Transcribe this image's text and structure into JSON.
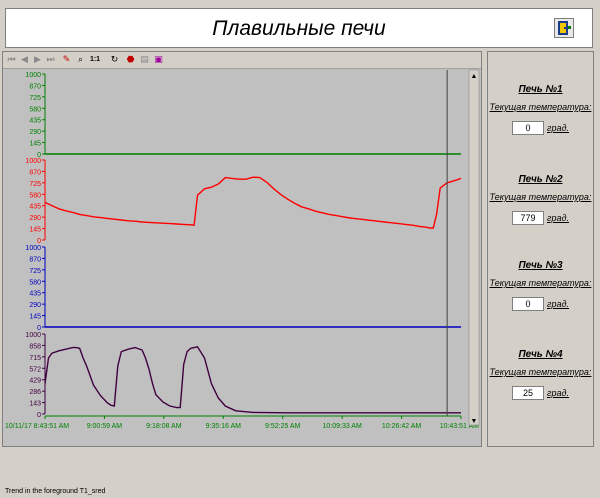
{
  "header": {
    "title": "Плавильные печи",
    "exit_icon": "door-exit-icon"
  },
  "toolbar": {
    "buttons": [
      "first-icon",
      "prev-icon",
      "next-icon",
      "last-icon",
      "pen-icon",
      "zoom-icon",
      "ratio-icon",
      "refresh-icon",
      "stop-icon",
      "print-icon",
      "export-icon"
    ],
    "ratio_label": "1:1"
  },
  "status": {
    "text": "Trend in the foreground T1_sred"
  },
  "colors": {
    "furnace1": "#008000",
    "furnace2": "#ff0000",
    "furnace3": "#0000c0",
    "furnace4": "#400040",
    "axis_time": "#008000",
    "plot_bg": "#c0c0c0"
  },
  "furnaces": [
    {
      "name": "Печь №1",
      "label": "Текущая температура:",
      "value": "0",
      "unit": "град."
    },
    {
      "name": "Печь №2",
      "label": "Текущая температура:",
      "value": "779",
      "unit": "град."
    },
    {
      "name": "Печь №3",
      "label": "Текущая температура:",
      "value": "0",
      "unit": "град."
    },
    {
      "name": "Печь №4",
      "label": "Текущая температура:",
      "value": "25",
      "unit": "град."
    }
  ],
  "chart_data": {
    "type": "line",
    "x_ticks": [
      "10/11/17 8:43:51 AM",
      "9:00:59 AM",
      "9:18:08 AM",
      "9:35:16 AM",
      "9:52:25 AM",
      "10:09:33 AM",
      "10:26:42 AM",
      "10:43:51 AM"
    ],
    "xlim": [
      0,
      120
    ],
    "cursor_x": 116,
    "panels": [
      {
        "ylim": [
          0,
          1000
        ],
        "y_ticks": [
          "0",
          "145",
          "290",
          "435",
          "580",
          "725",
          "870",
          "1000"
        ],
        "x": [
          0,
          120
        ],
        "y": [
          0,
          0
        ]
      },
      {
        "ylim": [
          0,
          1000
        ],
        "y_ticks": [
          "0",
          "145",
          "290",
          "435",
          "580",
          "725",
          "870",
          "1000"
        ],
        "x": [
          0,
          2,
          4,
          6,
          8,
          10,
          12,
          14,
          16,
          18,
          20,
          22,
          24,
          26,
          28,
          30,
          32,
          34,
          36,
          38,
          40,
          42,
          43,
          44,
          46,
          48,
          50,
          52,
          54,
          56,
          58,
          60,
          62,
          64,
          66,
          68,
          70,
          72,
          74,
          76,
          78,
          80,
          82,
          84,
          86,
          88,
          90,
          92,
          94,
          96,
          98,
          100,
          102,
          104,
          106,
          108,
          110,
          111,
          112,
          113,
          114,
          116,
          118,
          120
        ],
        "y": [
          470,
          430,
          390,
          365,
          345,
          320,
          305,
          290,
          280,
          270,
          260,
          250,
          240,
          235,
          225,
          220,
          215,
          210,
          205,
          200,
          195,
          190,
          185,
          560,
          640,
          660,
          700,
          780,
          770,
          760,
          760,
          785,
          780,
          720,
          640,
          570,
          510,
          460,
          415,
          390,
          360,
          340,
          320,
          305,
          290,
          275,
          265,
          255,
          245,
          235,
          225,
          215,
          205,
          195,
          185,
          170,
          160,
          150,
          150,
          330,
          650,
          715,
          740,
          770
        ]
      },
      {
        "ylim": [
          0,
          1000
        ],
        "y_ticks": [
          "0",
          "145",
          "290",
          "435",
          "580",
          "725",
          "870",
          "1000"
        ],
        "x": [
          0,
          120
        ],
        "y": [
          0,
          0
        ]
      },
      {
        "ylim": [
          0,
          1000
        ],
        "y_ticks": [
          "0",
          "143",
          "286",
          "429",
          "572",
          "715",
          "858",
          "1000"
        ],
        "x": [
          0,
          1,
          2,
          4,
          6,
          8,
          9,
          10,
          11,
          12,
          13,
          14,
          16,
          18,
          19,
          20,
          21,
          22,
          24,
          26,
          28,
          29,
          30,
          31,
          32,
          34,
          36,
          38,
          39,
          40,
          41,
          42,
          44,
          46,
          48,
          50,
          52,
          55,
          60,
          70,
          80,
          90,
          100,
          110,
          120
        ],
        "y": [
          380,
          700,
          760,
          790,
          810,
          830,
          830,
          820,
          700,
          600,
          480,
          360,
          230,
          140,
          110,
          100,
          600,
          780,
          810,
          830,
          800,
          700,
          560,
          380,
          240,
          150,
          100,
          80,
          80,
          620,
          780,
          820,
          840,
          700,
          380,
          200,
          100,
          40,
          20,
          15,
          15,
          15,
          15,
          15,
          15
        ]
      }
    ]
  }
}
